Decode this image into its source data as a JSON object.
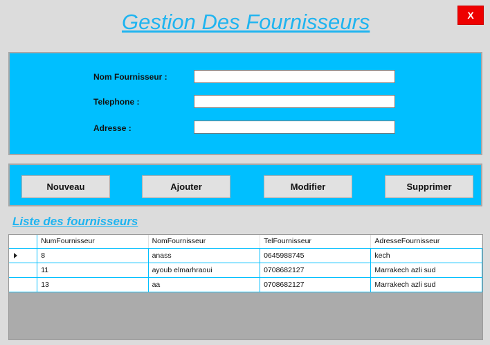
{
  "window": {
    "title": "Gestion Des Fournisseurs",
    "close_label": "X"
  },
  "form": {
    "nom_label": "Nom Fournisseur :",
    "nom_value": "",
    "telephone_label": "Telephone :",
    "telephone_value": "",
    "adresse_label": "Adresse :",
    "adresse_value": ""
  },
  "actions": {
    "nouveau": "Nouveau",
    "ajouter": "Ajouter",
    "modifier": "Modifier",
    "supprimer": "Supprimer"
  },
  "list": {
    "title": "Liste des fournisseurs",
    "columns": [
      "NumFournisseur",
      "NomFournisseur",
      "TelFournisseur",
      "AdresseFournisseur"
    ],
    "rows": [
      [
        "8",
        "anass",
        "0645988745",
        "kech"
      ],
      [
        "11",
        "ayoub elmarhraoui",
        "0708682127",
        "Marrakech azli sud"
      ],
      [
        "13",
        "aa",
        "0708682127",
        "Marrakech azli sud"
      ]
    ],
    "current_row": 0
  }
}
